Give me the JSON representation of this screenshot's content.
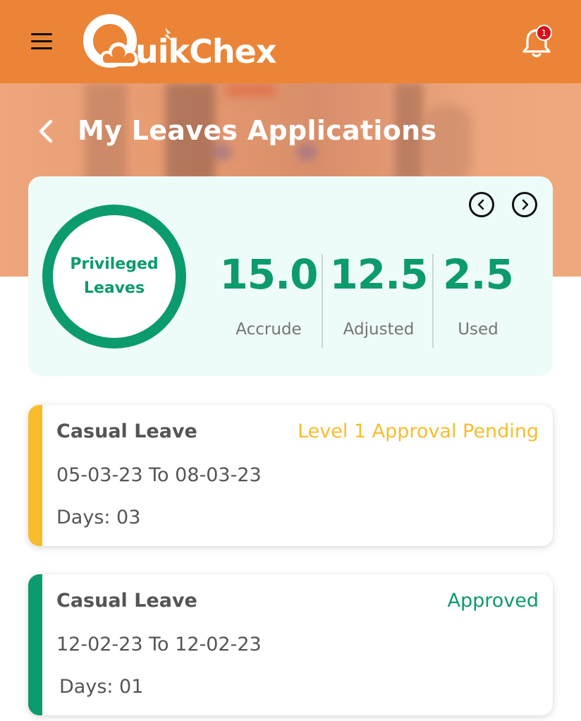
{
  "header": {
    "app_name": "uikChex",
    "notification_count": "1"
  },
  "page": {
    "title": "My Leaves Applications"
  },
  "summary": {
    "leave_type": "Privileged Leaves",
    "stats": [
      {
        "value": "15.0",
        "label": "Accrude"
      },
      {
        "value": "12.5",
        "label": "Adjusted"
      },
      {
        "value": "2.5",
        "label": "Used"
      }
    ]
  },
  "applications": [
    {
      "type": "Casual Leave",
      "status": "Level 1 Approval Pending",
      "status_color": "#f7bd2c",
      "dates": "05-03-23 To 08-03-23",
      "days": "Days: 03"
    },
    {
      "type": "Casual Leave",
      "status": "Approved",
      "status_color": "#0c9a6f",
      "dates": "12-02-23 To 12-02-23",
      "days": "Days: 01"
    }
  ],
  "colors": {
    "header_bg": "#eb8436",
    "accent_green": "#0c9a6f",
    "pending_yellow": "#f7bd2c"
  },
  "icons": {
    "menu": "hamburger-menu-icon",
    "notifications": "bell-icon",
    "back": "chevron-left-icon",
    "prev": "circle-chevron-left-icon",
    "next": "circle-chevron-right-icon"
  }
}
